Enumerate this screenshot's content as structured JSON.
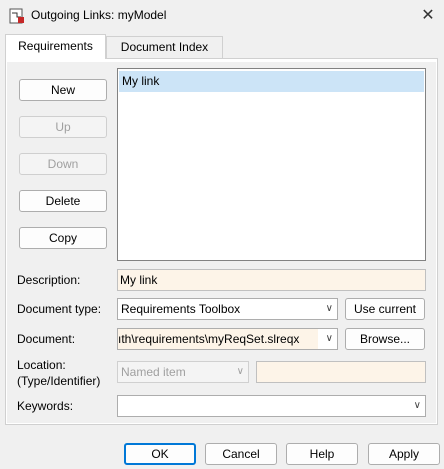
{
  "window": {
    "title": "Outgoing Links: myModel",
    "app_icon": "model-link-icon",
    "close_icon": "close-icon"
  },
  "tabs": [
    {
      "label": "Requirements",
      "active": true
    },
    {
      "label": "Document Index",
      "active": false
    }
  ],
  "side_buttons": {
    "new": "New",
    "up": "Up",
    "down": "Down",
    "delete": "Delete",
    "copy": "Copy"
  },
  "links": {
    "items": [
      "My link"
    ],
    "selected": "My link"
  },
  "form": {
    "description_label": "Description:",
    "description_value": "My link",
    "doctype_label": "Document type:",
    "doctype_value": "Requirements Toolbox",
    "use_current": "Use current",
    "document_label": "Document:",
    "document_value": "ıth\\requirements\\myReqSet.slreqx",
    "browse": "Browse...",
    "location_label_1": "Location:",
    "location_label_2": "(Type/Identifier)",
    "location_type_value": "Named item",
    "location_id_value": "",
    "keywords_label": "Keywords:",
    "keywords_value": ""
  },
  "footer": {
    "ok": "OK",
    "cancel": "Cancel",
    "help": "Help",
    "apply": "Apply"
  },
  "colors": {
    "selection": "#cce4f7",
    "focus": "#0078d7",
    "editable_field": "#fdf4e8"
  }
}
